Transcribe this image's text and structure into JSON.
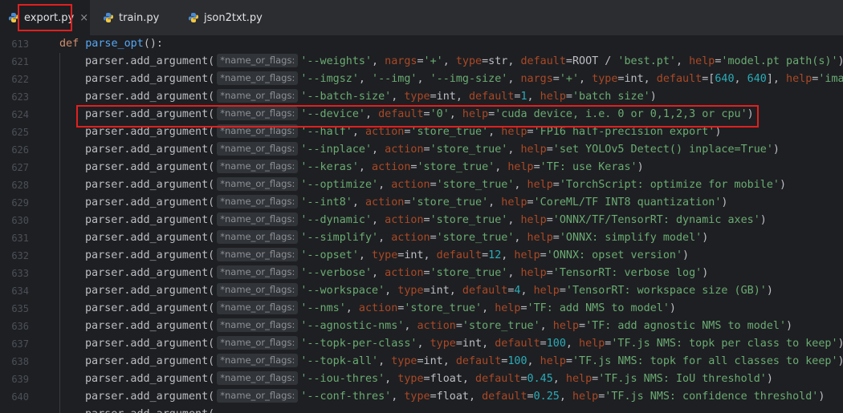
{
  "tabs": [
    {
      "label": "export.py",
      "active": true,
      "closable": true
    },
    {
      "label": "train.py",
      "active": false
    },
    {
      "label": "json2txt.py",
      "active": false
    }
  ],
  "hint_label": "*name_or_flags:",
  "editor": {
    "header_line": {
      "number": "613",
      "text_kw": "def",
      "text_fn": "parse_opt",
      "text_rest": "():"
    },
    "lines": [
      {
        "number": "621",
        "arg": "'--weights'",
        "rest": [
          [
            "plain",
            ", "
          ],
          [
            "param",
            "nargs"
          ],
          [
            "plain",
            "="
          ],
          [
            "str",
            "'+'"
          ],
          [
            "plain",
            ", "
          ],
          [
            "param",
            "type"
          ],
          [
            "plain",
            "="
          ],
          [
            "plain",
            "str"
          ],
          [
            "plain",
            ", "
          ],
          [
            "param",
            "default"
          ],
          [
            "plain",
            "=ROOT / "
          ],
          [
            "str",
            "'best.pt'"
          ],
          [
            "plain",
            ", "
          ],
          [
            "param",
            "help"
          ],
          [
            "plain",
            "="
          ],
          [
            "str",
            "'model.pt path(s)'"
          ],
          [
            "plain",
            ")"
          ]
        ]
      },
      {
        "number": "622",
        "arg": "'--imgsz'",
        "rest": [
          [
            "plain",
            ", "
          ],
          [
            "str",
            "'--img'"
          ],
          [
            "plain",
            ", "
          ],
          [
            "str",
            "'--img-size'"
          ],
          [
            "plain",
            ", "
          ],
          [
            "param",
            "nargs"
          ],
          [
            "plain",
            "="
          ],
          [
            "str",
            "'+'"
          ],
          [
            "plain",
            ", "
          ],
          [
            "param",
            "type"
          ],
          [
            "plain",
            "="
          ],
          [
            "plain",
            "int"
          ],
          [
            "plain",
            ", "
          ],
          [
            "param",
            "default"
          ],
          [
            "plain",
            "=["
          ],
          [
            "num",
            "640"
          ],
          [
            "plain",
            ", "
          ],
          [
            "num",
            "640"
          ],
          [
            "plain",
            "], "
          ],
          [
            "param",
            "help"
          ],
          [
            "plain",
            "="
          ],
          [
            "str",
            "'imag"
          ]
        ]
      },
      {
        "number": "623",
        "arg": "'--batch-size'",
        "rest": [
          [
            "plain",
            ", "
          ],
          [
            "param",
            "type"
          ],
          [
            "plain",
            "="
          ],
          [
            "plain",
            "int"
          ],
          [
            "plain",
            ", "
          ],
          [
            "param",
            "default"
          ],
          [
            "plain",
            "="
          ],
          [
            "num",
            "1"
          ],
          [
            "plain",
            ", "
          ],
          [
            "param",
            "help"
          ],
          [
            "plain",
            "="
          ],
          [
            "str",
            "'batch size'"
          ],
          [
            "plain",
            ")"
          ]
        ]
      },
      {
        "number": "624",
        "arg": "'--device'",
        "rest": [
          [
            "plain",
            ", "
          ],
          [
            "param",
            "default"
          ],
          [
            "plain",
            "="
          ],
          [
            "str",
            "'0'"
          ],
          [
            "plain",
            ", "
          ],
          [
            "param",
            "help"
          ],
          [
            "plain",
            "="
          ],
          [
            "str",
            "'cuda device, i.e. 0 or 0,1,2,3 or cpu'"
          ],
          [
            "plain",
            ")"
          ]
        ]
      },
      {
        "number": "625",
        "arg": "'--half'",
        "rest": [
          [
            "plain",
            ", "
          ],
          [
            "param",
            "action"
          ],
          [
            "plain",
            "="
          ],
          [
            "str",
            "'store_true'"
          ],
          [
            "plain",
            ", "
          ],
          [
            "param",
            "help"
          ],
          [
            "plain",
            "="
          ],
          [
            "str",
            "'FP16 half-precision export'"
          ],
          [
            "plain",
            ")"
          ]
        ]
      },
      {
        "number": "626",
        "arg": "'--inplace'",
        "rest": [
          [
            "plain",
            ", "
          ],
          [
            "param",
            "action"
          ],
          [
            "plain",
            "="
          ],
          [
            "str",
            "'store_true'"
          ],
          [
            "plain",
            ", "
          ],
          [
            "param",
            "help"
          ],
          [
            "plain",
            "="
          ],
          [
            "str",
            "'set YOLOv5 Detect() inplace=True'"
          ],
          [
            "plain",
            ")"
          ]
        ]
      },
      {
        "number": "627",
        "arg": "'--keras'",
        "rest": [
          [
            "plain",
            ", "
          ],
          [
            "param",
            "action"
          ],
          [
            "plain",
            "="
          ],
          [
            "str",
            "'store_true'"
          ],
          [
            "plain",
            ", "
          ],
          [
            "param",
            "help"
          ],
          [
            "plain",
            "="
          ],
          [
            "str",
            "'TF: use Keras'"
          ],
          [
            "plain",
            ")"
          ]
        ]
      },
      {
        "number": "628",
        "arg": "'--optimize'",
        "rest": [
          [
            "plain",
            ", "
          ],
          [
            "param",
            "action"
          ],
          [
            "plain",
            "="
          ],
          [
            "str",
            "'store_true'"
          ],
          [
            "plain",
            ", "
          ],
          [
            "param",
            "help"
          ],
          [
            "plain",
            "="
          ],
          [
            "str",
            "'TorchScript: optimize for mobile'"
          ],
          [
            "plain",
            ")"
          ]
        ]
      },
      {
        "number": "629",
        "arg": "'--int8'",
        "rest": [
          [
            "plain",
            ", "
          ],
          [
            "param",
            "action"
          ],
          [
            "plain",
            "="
          ],
          [
            "str",
            "'store_true'"
          ],
          [
            "plain",
            ", "
          ],
          [
            "param",
            "help"
          ],
          [
            "plain",
            "="
          ],
          [
            "str",
            "'CoreML/TF INT8 quantization'"
          ],
          [
            "plain",
            ")"
          ]
        ]
      },
      {
        "number": "630",
        "arg": "'--dynamic'",
        "rest": [
          [
            "plain",
            ", "
          ],
          [
            "param",
            "action"
          ],
          [
            "plain",
            "="
          ],
          [
            "str",
            "'store_true'"
          ],
          [
            "plain",
            ", "
          ],
          [
            "param",
            "help"
          ],
          [
            "plain",
            "="
          ],
          [
            "str",
            "'ONNX/TF/TensorRT: dynamic axes'"
          ],
          [
            "plain",
            ")"
          ]
        ]
      },
      {
        "number": "631",
        "arg": "'--simplify'",
        "rest": [
          [
            "plain",
            ", "
          ],
          [
            "param",
            "action"
          ],
          [
            "plain",
            "="
          ],
          [
            "str",
            "'store_true'"
          ],
          [
            "plain",
            ", "
          ],
          [
            "param",
            "help"
          ],
          [
            "plain",
            "="
          ],
          [
            "str",
            "'ONNX: simplify model'"
          ],
          [
            "plain",
            ")"
          ]
        ]
      },
      {
        "number": "632",
        "arg": "'--opset'",
        "rest": [
          [
            "plain",
            ", "
          ],
          [
            "param",
            "type"
          ],
          [
            "plain",
            "="
          ],
          [
            "plain",
            "int"
          ],
          [
            "plain",
            ", "
          ],
          [
            "param",
            "default"
          ],
          [
            "plain",
            "="
          ],
          [
            "num",
            "12"
          ],
          [
            "plain",
            ", "
          ],
          [
            "param",
            "help"
          ],
          [
            "plain",
            "="
          ],
          [
            "str",
            "'ONNX: opset version'"
          ],
          [
            "plain",
            ")"
          ]
        ]
      },
      {
        "number": "633",
        "arg": "'--verbose'",
        "rest": [
          [
            "plain",
            ", "
          ],
          [
            "param",
            "action"
          ],
          [
            "plain",
            "="
          ],
          [
            "str",
            "'store_true'"
          ],
          [
            "plain",
            ", "
          ],
          [
            "param",
            "help"
          ],
          [
            "plain",
            "="
          ],
          [
            "str",
            "'TensorRT: verbose log'"
          ],
          [
            "plain",
            ")"
          ]
        ]
      },
      {
        "number": "634",
        "arg": "'--workspace'",
        "rest": [
          [
            "plain",
            ", "
          ],
          [
            "param",
            "type"
          ],
          [
            "plain",
            "="
          ],
          [
            "plain",
            "int"
          ],
          [
            "plain",
            ", "
          ],
          [
            "param",
            "default"
          ],
          [
            "plain",
            "="
          ],
          [
            "num",
            "4"
          ],
          [
            "plain",
            ", "
          ],
          [
            "param",
            "help"
          ],
          [
            "plain",
            "="
          ],
          [
            "str",
            "'TensorRT: workspace size (GB)'"
          ],
          [
            "plain",
            ")"
          ]
        ]
      },
      {
        "number": "635",
        "arg": "'--nms'",
        "rest": [
          [
            "plain",
            ", "
          ],
          [
            "param",
            "action"
          ],
          [
            "plain",
            "="
          ],
          [
            "str",
            "'store_true'"
          ],
          [
            "plain",
            ", "
          ],
          [
            "param",
            "help"
          ],
          [
            "plain",
            "="
          ],
          [
            "str",
            "'TF: add NMS to model'"
          ],
          [
            "plain",
            ")"
          ]
        ]
      },
      {
        "number": "636",
        "arg": "'--agnostic-nms'",
        "rest": [
          [
            "plain",
            ", "
          ],
          [
            "param",
            "action"
          ],
          [
            "plain",
            "="
          ],
          [
            "str",
            "'store_true'"
          ],
          [
            "plain",
            ", "
          ],
          [
            "param",
            "help"
          ],
          [
            "plain",
            "="
          ],
          [
            "str",
            "'TF: add agnostic NMS to model'"
          ],
          [
            "plain",
            ")"
          ]
        ]
      },
      {
        "number": "637",
        "arg": "'--topk-per-class'",
        "rest": [
          [
            "plain",
            ", "
          ],
          [
            "param",
            "type"
          ],
          [
            "plain",
            "="
          ],
          [
            "plain",
            "int"
          ],
          [
            "plain",
            ", "
          ],
          [
            "param",
            "default"
          ],
          [
            "plain",
            "="
          ],
          [
            "num",
            "100"
          ],
          [
            "plain",
            ", "
          ],
          [
            "param",
            "help"
          ],
          [
            "plain",
            "="
          ],
          [
            "str",
            "'TF.js NMS: topk per class to keep'"
          ],
          [
            "plain",
            ")"
          ]
        ]
      },
      {
        "number": "638",
        "arg": "'--topk-all'",
        "rest": [
          [
            "plain",
            ", "
          ],
          [
            "param",
            "type"
          ],
          [
            "plain",
            "="
          ],
          [
            "plain",
            "int"
          ],
          [
            "plain",
            ", "
          ],
          [
            "param",
            "default"
          ],
          [
            "plain",
            "="
          ],
          [
            "num",
            "100"
          ],
          [
            "plain",
            ", "
          ],
          [
            "param",
            "help"
          ],
          [
            "plain",
            "="
          ],
          [
            "str",
            "'TF.js NMS: topk for all classes to keep'"
          ],
          [
            "plain",
            ")"
          ]
        ]
      },
      {
        "number": "639",
        "arg": "'--iou-thres'",
        "rest": [
          [
            "plain",
            ", "
          ],
          [
            "param",
            "type"
          ],
          [
            "plain",
            "="
          ],
          [
            "plain",
            "float"
          ],
          [
            "plain",
            ", "
          ],
          [
            "param",
            "default"
          ],
          [
            "plain",
            "="
          ],
          [
            "num",
            "0.45"
          ],
          [
            "plain",
            ", "
          ],
          [
            "param",
            "help"
          ],
          [
            "plain",
            "="
          ],
          [
            "str",
            "'TF.js NMS: IoU threshold'"
          ],
          [
            "plain",
            ")"
          ]
        ]
      },
      {
        "number": "640",
        "arg": "'--conf-thres'",
        "rest": [
          [
            "plain",
            ", "
          ],
          [
            "param",
            "type"
          ],
          [
            "plain",
            "="
          ],
          [
            "plain",
            "float"
          ],
          [
            "plain",
            ", "
          ],
          [
            "param",
            "default"
          ],
          [
            "plain",
            "="
          ],
          [
            "num",
            "0.25"
          ],
          [
            "plain",
            ", "
          ],
          [
            "param",
            "help"
          ],
          [
            "plain",
            "="
          ],
          [
            "str",
            "'TF.js NMS: confidence threshold'"
          ],
          [
            "plain",
            ")"
          ]
        ]
      }
    ],
    "call_prefix": "parser.add_argument(",
    "partial_last_line": "parser.add_argument("
  },
  "colors": {
    "background": "#1e1f22",
    "tabbar": "#2b2d30",
    "keyword": "#cf8e6d",
    "function": "#56a8f5",
    "string": "#6aab73",
    "number": "#2aacb8",
    "parameter": "#aa4926",
    "highlight_box": "#e02020"
  },
  "icons": {
    "tab_file": "python-file-icon",
    "tab_close": "close-icon"
  }
}
